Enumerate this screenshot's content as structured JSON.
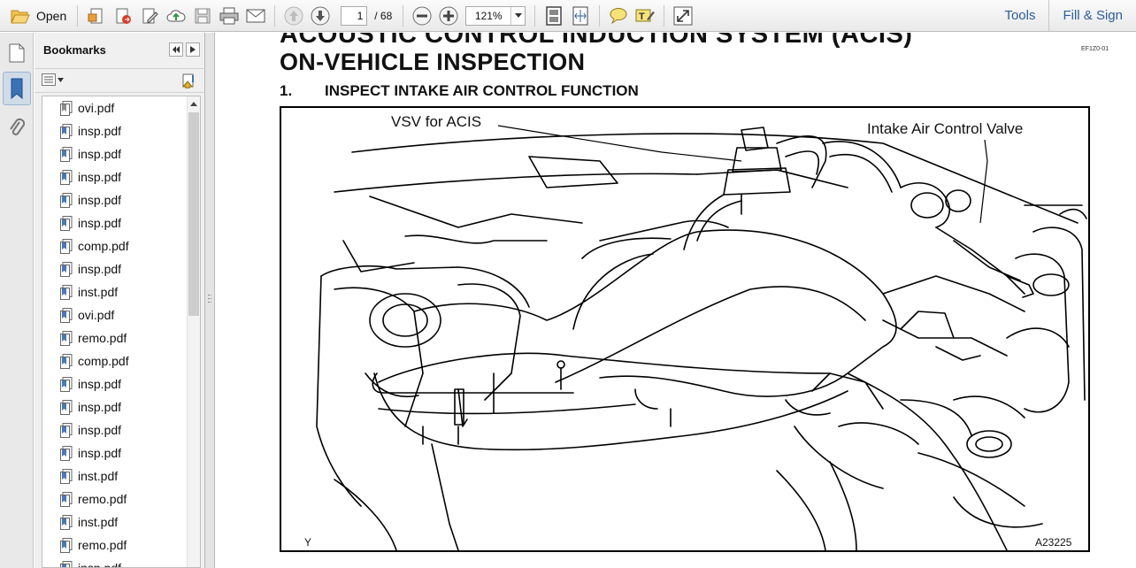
{
  "toolbar": {
    "open_label": "Open",
    "page_current": "1",
    "page_total": "/ 68",
    "zoom": "121%",
    "tools_label": "Tools",
    "fill_sign_label": "Fill & Sign"
  },
  "bookmarks": {
    "title": "Bookmarks",
    "items": [
      {
        "label": "ovi.pdf"
      },
      {
        "label": "insp.pdf"
      },
      {
        "label": "insp.pdf"
      },
      {
        "label": "insp.pdf"
      },
      {
        "label": "insp.pdf"
      },
      {
        "label": "insp.pdf"
      },
      {
        "label": "comp.pdf"
      },
      {
        "label": "insp.pdf"
      },
      {
        "label": "inst.pdf"
      },
      {
        "label": "ovi.pdf"
      },
      {
        "label": "remo.pdf"
      },
      {
        "label": "comp.pdf"
      },
      {
        "label": "insp.pdf"
      },
      {
        "label": "insp.pdf"
      },
      {
        "label": "insp.pdf"
      },
      {
        "label": "insp.pdf"
      },
      {
        "label": "inst.pdf"
      },
      {
        "label": "remo.pdf"
      },
      {
        "label": "inst.pdf"
      },
      {
        "label": "remo.pdf"
      },
      {
        "label": "insp.pdf"
      }
    ]
  },
  "document": {
    "top_cut_heading": "ACOUSTIC CONTROL INDUCTION SYSTEM (ACIS)",
    "doc_code": "EF1Z0-01",
    "title": "ON-VEHICLE  INSPECTION",
    "step_number": "1.",
    "step_text": "INSPECT INTAKE AIR CONTROL FUNCTION",
    "figure": {
      "label_vsv": "VSV for ACIS",
      "label_valve": "Intake Air Control Valve",
      "corner_left": "Y",
      "corner_right": "A23225"
    }
  },
  "colors": {
    "link": "#2b5d9b",
    "toolbar_bg": "#eeeeee",
    "panel_bg": "#f0f0f0"
  },
  "icons": [
    "folder-open-icon",
    "create-pdf-icon",
    "export-pdf-icon",
    "edit-pdf-icon",
    "upload-cloud-icon",
    "save-icon",
    "print-icon",
    "email-icon",
    "previous-page-icon",
    "next-page-icon",
    "zoom-out-icon",
    "zoom-in-icon",
    "fit-page-icon",
    "fit-width-icon",
    "comment-icon",
    "highlight-icon",
    "fullscreen-icon"
  ]
}
